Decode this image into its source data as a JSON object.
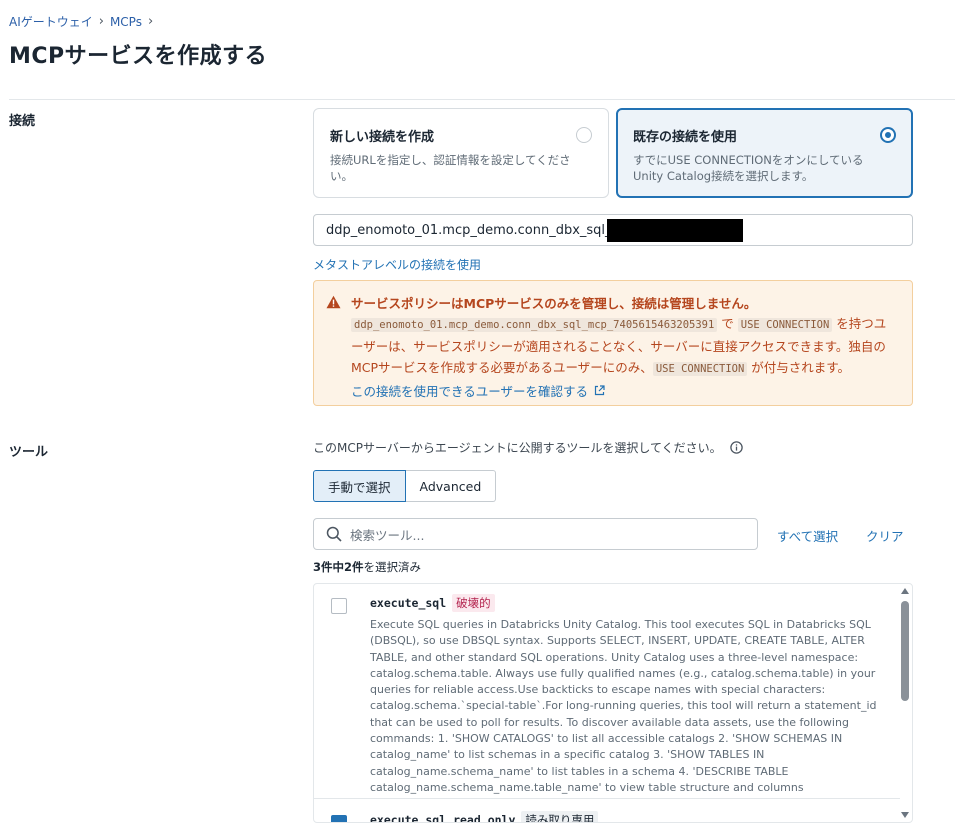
{
  "breadcrumb": {
    "items": [
      "AIゲートウェイ",
      "MCPs"
    ],
    "separator": "›"
  },
  "page": {
    "title": "MCPサービスを作成する"
  },
  "connection": {
    "label": "接続",
    "options": [
      {
        "title": "新しい接続を作成",
        "description": "接続URLを指定し、認証情報を設定してください。",
        "selected": false
      },
      {
        "title": "既存の接続を使用",
        "description": "すでにUSE CONNECTIONをオンにしているUnity Catalog接続を選択します。",
        "selected": true
      }
    ],
    "input_value": "ddp_enomoto_01.mcp_demo.conn_dbx_sql_mcp_",
    "metastore_link": "メタストアレベルの接続を使用",
    "warning": {
      "headline": "サービスポリシーはMCPサービスのみを管理し、接続は管理しません。",
      "code_connection": "ddp_enomoto_01.mcp_demo.conn_dbx_sql_mcp_7405615463205391",
      "text_1": " で ",
      "code_use": "USE CONNECTION",
      "text_2": " を持つユーザーは、サービスポリシーが適用されることなく、サーバーに直接アクセスできます。独自のMCPサービスを作成する必要があるユーザーにのみ、",
      "code_use_2": "USE CONNECTION",
      "text_3": " が付与されます。",
      "link": "この接続を使用できるユーザーを確認する"
    }
  },
  "tools": {
    "label": "ツール",
    "description": "このMCPサーバーからエージェントに公開するツールを選択してください。",
    "modes": [
      "手動で選択",
      "Advanced"
    ],
    "active_mode": "手動で選択",
    "search_placeholder": "検索ツール...",
    "select_all": "すべて選択",
    "clear": "クリア",
    "count": {
      "prefix": "3件中2件",
      "suffix": "を選択済み"
    },
    "items": [
      {
        "name": "execute_sql",
        "badge": "破壊的",
        "checked": false,
        "description": "Execute SQL queries in Databricks Unity Catalog. This tool executes SQL in Databricks SQL (DBSQL), so use DBSQL syntax. Supports SELECT, INSERT, UPDATE, CREATE TABLE, ALTER TABLE, and other standard SQL operations. Unity Catalog uses a three-level namespace: catalog.schema.table. Always use fully qualified names (e.g., catalog.schema.table) in your queries for reliable access.Use backticks to escape names with special characters: catalog.schema.`special-table`.For long-running queries, this tool will return a statement_id that can be used to poll for results. To discover available data assets, use the following commands: 1. 'SHOW CATALOGS' to list all accessible catalogs 2. 'SHOW SCHEMAS IN catalog_name' to list schemas in a specific catalog 3. 'SHOW TABLES IN catalog_name.schema_name' to list tables in a schema 4. 'DESCRIBE TABLE catalog_name.schema_name.table_name' to view table structure and columns"
      },
      {
        "name": "execute_sql_read_only",
        "badge": "読み取り専用",
        "checked": true
      }
    ]
  },
  "colors": {
    "primary": "#2272b4",
    "warning_text": "#b5461e",
    "warning_bg": "#fdf3e7",
    "danger_badge": "#b3224d"
  }
}
